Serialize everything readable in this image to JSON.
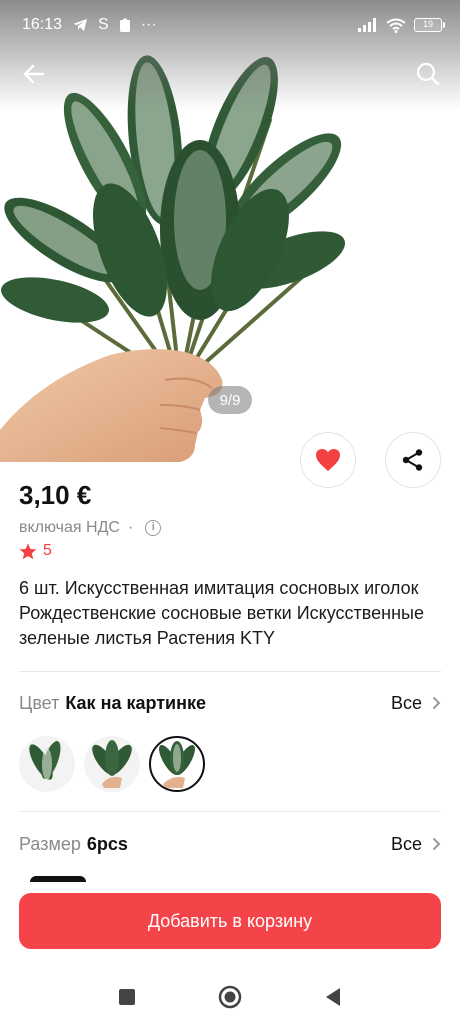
{
  "status_bar": {
    "time": "16:13",
    "sim_letter": "S",
    "more": "···",
    "battery": "19"
  },
  "gallery": {
    "counter": "9/9"
  },
  "product": {
    "price": "3,10 €",
    "vat_text": "включая НДС",
    "vat_separator": "·",
    "info_glyph": "i",
    "rating": "5",
    "title": "6 шт. Искусственная имитация сосновых иголок Рождественские сосновые ветки Искусственные зеленые листья Растения KTY"
  },
  "color_option": {
    "label": "Цвет",
    "value": "Как на картинке",
    "all": "Все",
    "selected_index": 2,
    "thumb_count": 3
  },
  "size_option": {
    "label": "Размер",
    "value": "6pcs",
    "all": "Все"
  },
  "cart": {
    "label": "Добавить в корзину"
  },
  "colors": {
    "accent": "#f54449",
    "heart": "#f24043",
    "muted": "#8a8a8a",
    "needle_dark": "#2f5a35",
    "needle_frost": "#d9e3d6"
  },
  "icons": [
    "back-arrow-icon",
    "search-icon",
    "heart-icon",
    "share-icon",
    "star-icon",
    "chevron-right-icon",
    "nav-square-icon",
    "nav-home-icon",
    "nav-back-icon"
  ]
}
